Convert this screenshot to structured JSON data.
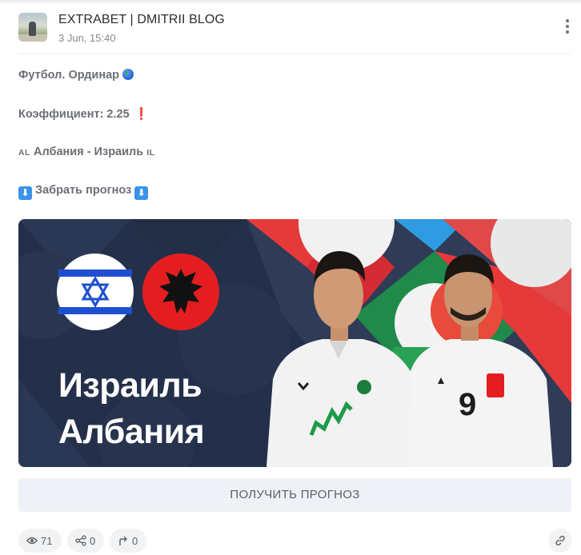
{
  "post": {
    "channel_name": "EXTRABET | DMITRII BLOG",
    "time": "3 Jun, 15:40",
    "lines": {
      "sport": "Футбол. Ординар",
      "coefficient": "Коэффициент: 2.25",
      "flag_left": "AL",
      "match": "Албания - Израиль",
      "flag_right": "IL",
      "arrow_left": "⬇",
      "forecast_label": "Забрать прогноз",
      "arrow_right": "⬇"
    },
    "banner": {
      "title_line1": "Израиль",
      "title_line2": "Албания",
      "shirt_number": "9"
    },
    "cta_label": "ПОЛУЧИТЬ ПРОГНОЗ",
    "stats": {
      "views": "71",
      "shares": "0",
      "forwards": "0"
    }
  },
  "colors": {
    "banner_bg": "#24304a",
    "israel_blue": "#1f4fd1",
    "albania_red": "#e41e20",
    "text_gray": "#6b6f76"
  },
  "icons": [
    "more-vertical-icon",
    "globe-icon",
    "exclamation-icon",
    "arrow-down-icon",
    "eye-icon",
    "share-icon",
    "forward-icon",
    "link-icon"
  ]
}
